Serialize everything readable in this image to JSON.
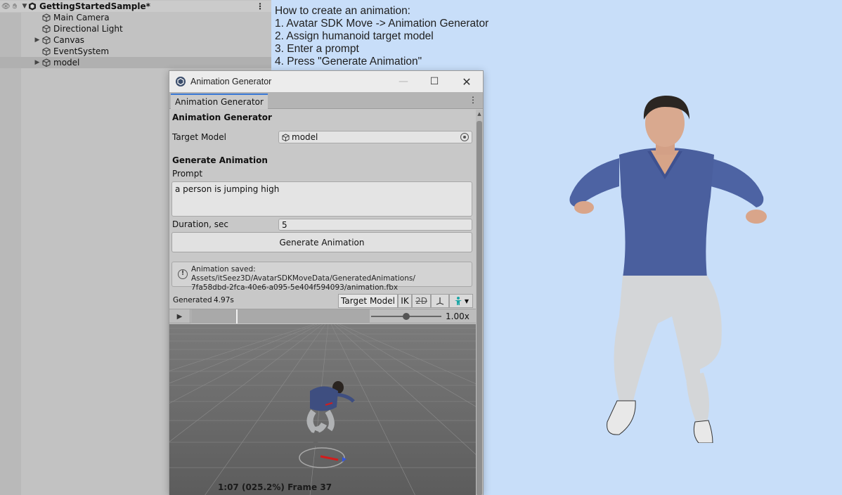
{
  "hierarchy": {
    "scene_name": "GettingStartedSample*",
    "items": [
      {
        "label": "Main Camera",
        "expandable": false
      },
      {
        "label": "Directional Light",
        "expandable": false
      },
      {
        "label": "Canvas",
        "expandable": true
      },
      {
        "label": "EventSystem",
        "expandable": false
      },
      {
        "label": "model",
        "expandable": true,
        "selected": true
      }
    ]
  },
  "game_view": {
    "instructions": [
      "How to create an animation:",
      "1. Avatar SDK Move -> Animation Generator",
      "2. Assign humanoid target model",
      "3. Enter a prompt",
      "4. Press \"Generate Animation\""
    ]
  },
  "window": {
    "title": "Animation Generator",
    "tab_label": "Animation Generator",
    "section_title": "Animation Generator",
    "target_model_label": "Target Model",
    "target_model_value": "model",
    "generate_section_title": "Generate Animation",
    "prompt_label": "Prompt",
    "prompt_value": "a person is jumping high",
    "duration_label": "Duration, sec",
    "duration_value": "5",
    "generate_button": "Generate Animation",
    "status_line1": "Animation saved: Assets/itSeez3D/AvatarSDKMoveData/GeneratedAnimations/",
    "status_line2": "7fa58dbd-2fca-40e6-a095-5e404f594093/animation.fbx",
    "preview": {
      "generated_label": "Generated",
      "generated_value": "4.97s",
      "target_model_button": "Target Model",
      "ik_button": "IK",
      "twod_button": "2D",
      "speed_value": "1.00x",
      "speed_fraction": 0.5,
      "playhead_fraction": 0.252,
      "frame_info": "1:07 (025.2%) Frame 37"
    }
  },
  "colors": {
    "game_background": "#c8def9",
    "tab_accent": "#3a79d6",
    "shirt": "#4a5f9e",
    "jeans": "#d4d6d8"
  }
}
